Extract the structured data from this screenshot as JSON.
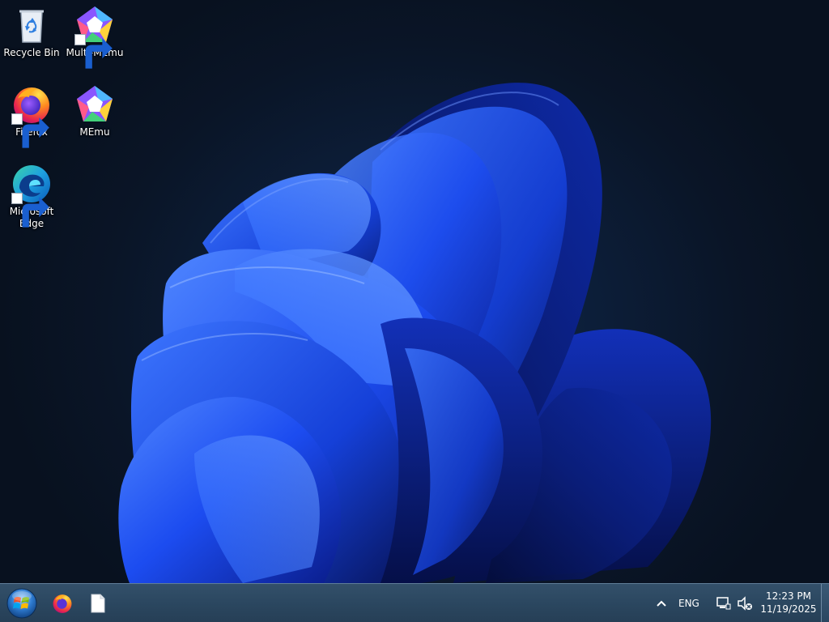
{
  "desktop": {
    "icons": [
      {
        "name": "recycle-bin-icon",
        "label": "Recycle Bin",
        "shortcut": false
      },
      {
        "name": "multi-memu-icon",
        "label": "Multi-MEmu",
        "shortcut": true
      },
      {
        "name": "firefox-icon",
        "label": "Firefox",
        "shortcut": true
      },
      {
        "name": "memu-icon",
        "label": "MEmu",
        "shortcut": true
      },
      {
        "name": "microsoft-edge-icon",
        "label": "Microsoft\nEdge",
        "shortcut": true
      }
    ],
    "wallpaper": "windows-11-bloom-blue"
  },
  "taskbar": {
    "start_icon": "windows-orb-icon",
    "pinned": [
      {
        "name": "taskbar-firefox-icon"
      },
      {
        "name": "taskbar-file-icon"
      }
    ],
    "tray": {
      "chevron_icon": "chevron-up-icon",
      "language": "ENG",
      "network_icon": "network-icon",
      "volume_icon": "volume-muted-icon"
    },
    "clock": {
      "time": "12:23 PM",
      "date": "11/19/2025"
    }
  },
  "colors": {
    "accent": "#1f4fff",
    "taskbar": "#2b4760",
    "desktop_bg": "#0b1526"
  }
}
